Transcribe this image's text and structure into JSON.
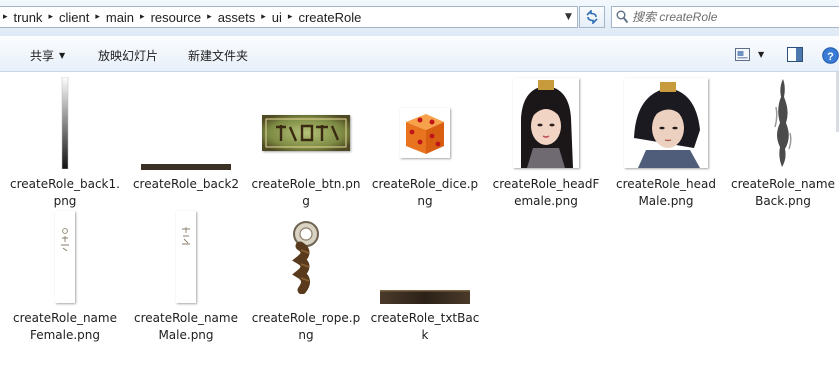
{
  "address_bar": {
    "crumbs": [
      "trunk",
      "client",
      "main",
      "resource",
      "assets",
      "ui",
      "createRole"
    ]
  },
  "search": {
    "placeholder": "搜索 createRole"
  },
  "toolbar": {
    "share_label": "共享",
    "slideshow_label": "放映幻灯片",
    "new_folder_label": "新建文件夹"
  },
  "files": [
    {
      "name": "createRole_back1.png",
      "icon": "vertical-gradient-strip"
    },
    {
      "name": "createRole_back2",
      "icon": "dark-horizontal-bar"
    },
    {
      "name": "createRole_btn.png",
      "icon": "enter-game-button"
    },
    {
      "name": "createRole_dice.png",
      "icon": "orange-dice"
    },
    {
      "name": "createRole_headFemale.png",
      "icon": "female-portrait"
    },
    {
      "name": "createRole_headMale.png",
      "icon": "male-portrait"
    },
    {
      "name": "createRole_nameBack.png",
      "icon": "ink-brush-stroke"
    },
    {
      "name": "createRole_nameFemale.png",
      "icon": "vertical-name-plate"
    },
    {
      "name": "createRole_nameMale.png",
      "icon": "vertical-name-plate"
    },
    {
      "name": "createRole_rope.png",
      "icon": "rope-ring"
    },
    {
      "name": "createRole_txtBack",
      "icon": "dark-text-bar"
    }
  ],
  "colors": {
    "accent": "#1e4f8c",
    "toolbar_bg": "#e7eff9",
    "border": "#a5b5c9"
  }
}
